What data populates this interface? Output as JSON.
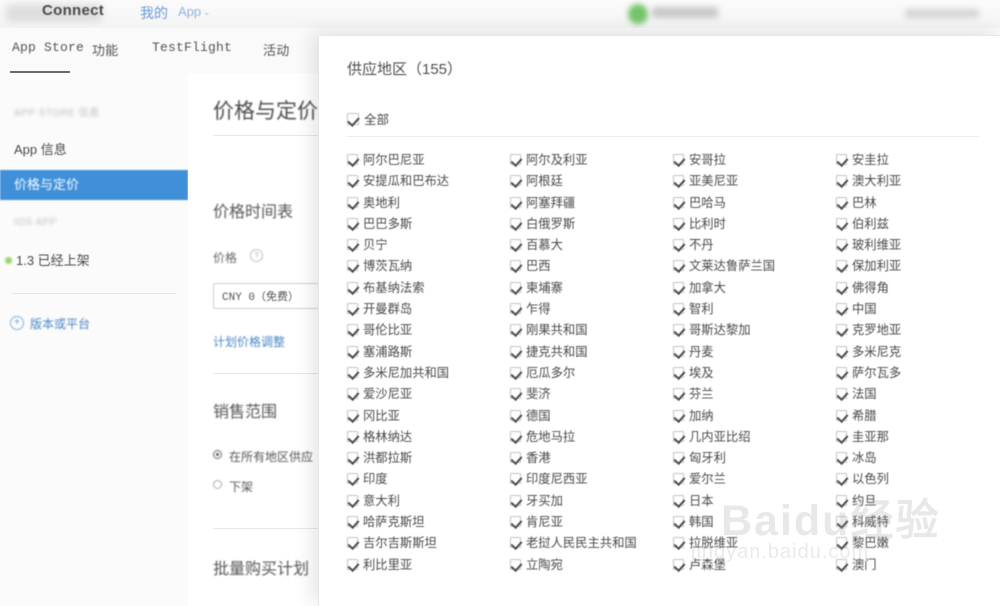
{
  "topbar": {
    "brand": "Connect",
    "nav_mine": "我的",
    "nav_app": "App",
    "caret": "⌄"
  },
  "tabs": [
    {
      "label": "App Store",
      "active": true
    },
    {
      "label": "功能",
      "active": false
    },
    {
      "label": "TestFlight",
      "active": false
    },
    {
      "label": "活动",
      "active": false
    }
  ],
  "sidebar": {
    "section_1_header": "APP STORE 信息",
    "items": [
      {
        "label": "App 信息",
        "selected": false
      },
      {
        "label": "价格与定价",
        "selected": true
      }
    ],
    "section_2_header": "IOS APP",
    "version_item": "1.3 已经上架",
    "add_link": "版本或平台"
  },
  "main": {
    "page_title": "价格与定价",
    "schedule_title": "价格时间表",
    "price_label": "价格",
    "help_icon": "?",
    "price_value": "CNY 0（免费）",
    "plan_link": "计划价格调整",
    "sales_title": "销售范围",
    "radios": [
      {
        "label": "在所有地区供应",
        "selected": true
      },
      {
        "label": "下架",
        "selected": false
      }
    ],
    "vpp_title": "批量购买计划"
  },
  "modal": {
    "title": "供应地区（155）",
    "select_all_label": "全部",
    "select_all_checked": true,
    "columns": [
      [
        "阿尔巴尼亚",
        "安提瓜和巴布达",
        "奥地利",
        "巴巴多斯",
        "贝宁",
        "博茨瓦纳",
        "布基纳法索",
        "开曼群岛",
        "哥伦比亚",
        "塞浦路斯",
        "多米尼加共和国",
        "爱沙尼亚",
        "冈比亚",
        "格林纳达",
        "洪都拉斯",
        "印度",
        "意大利",
        "哈萨克斯坦",
        "吉尔吉斯斯坦",
        "利比里亚"
      ],
      [
        "阿尔及利亚",
        "阿根廷",
        "阿塞拜疆",
        "白俄罗斯",
        "百慕大",
        "巴西",
        "柬埔寨",
        "乍得",
        "刚果共和国",
        "捷克共和国",
        "厄瓜多尔",
        "斐济",
        "德国",
        "危地马拉",
        "香港",
        "印度尼西亚",
        "牙买加",
        "肯尼亚",
        "老挝人民民主共和国",
        "立陶宛"
      ],
      [
        "安哥拉",
        "亚美尼亚",
        "巴哈马",
        "比利时",
        "不丹",
        "文莱达鲁萨兰国",
        "加拿大",
        "智利",
        "哥斯达黎加",
        "丹麦",
        "埃及",
        "芬兰",
        "加纳",
        "几内亚比绍",
        "匈牙利",
        "爱尔兰",
        "日本",
        "韩国",
        "拉脱维亚",
        "卢森堡"
      ],
      [
        "安圭拉",
        "澳大利亚",
        "巴林",
        "伯利兹",
        "玻利维亚",
        "保加利亚",
        "佛得角",
        "中国",
        "克罗地亚",
        "多米尼克",
        "萨尔瓦多",
        "法国",
        "希腊",
        "圭亚那",
        "冰岛",
        "以色列",
        "约旦",
        "科威特",
        "黎巴嫩",
        "澳门"
      ]
    ]
  },
  "watermark": {
    "main": "Baidu经验",
    "sub": "jingyan.baidu.com"
  }
}
